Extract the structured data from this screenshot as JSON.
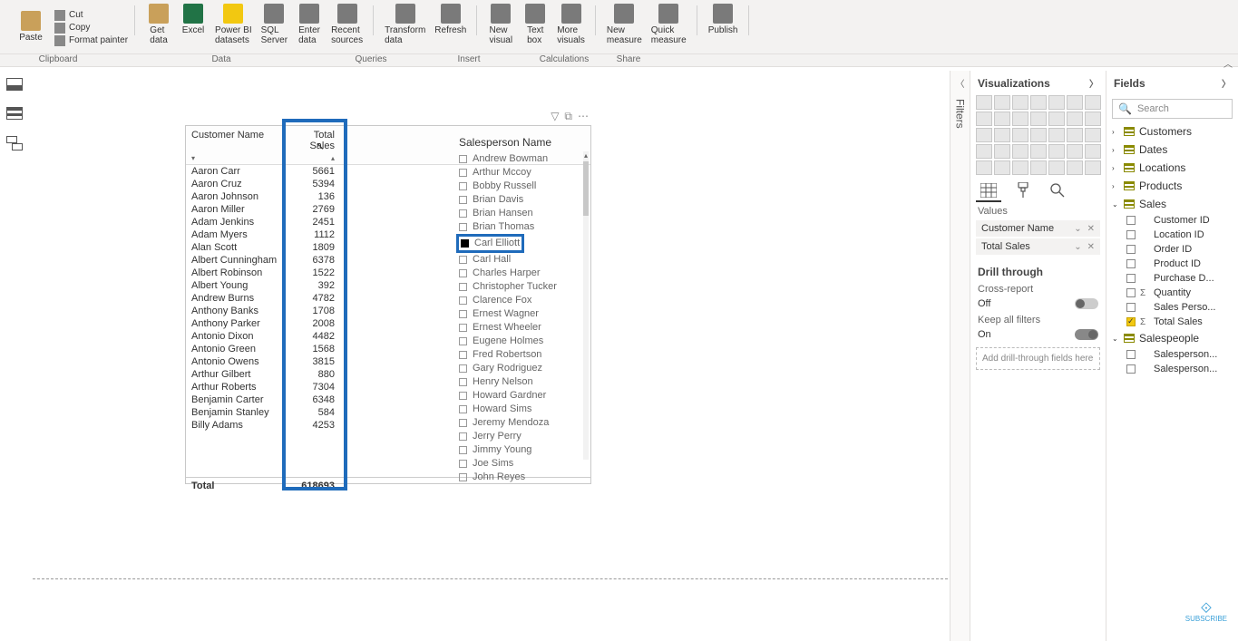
{
  "ribbon": {
    "clipboard": {
      "paste": "Paste",
      "cut": "Cut",
      "copy": "Copy",
      "format_painter": "Format painter",
      "group": "Clipboard"
    },
    "data": {
      "get_data": "Get\ndata",
      "excel": "Excel",
      "pbi_datasets": "Power BI\ndatasets",
      "sql": "SQL\nServer",
      "enter": "Enter\ndata",
      "recent": "Recent\nsources",
      "group": "Data"
    },
    "queries": {
      "transform": "Transform\ndata",
      "refresh": "Refresh",
      "group": "Queries"
    },
    "insert": {
      "new_visual": "New\nvisual",
      "text_box": "Text\nbox",
      "more_visuals": "More\nvisuals",
      "group": "Insert"
    },
    "calc": {
      "new_measure": "New\nmeasure",
      "quick_measure": "Quick\nmeasure",
      "group": "Calculations"
    },
    "share": {
      "publish": "Publish",
      "group": "Share"
    }
  },
  "filters_rail": "Filters",
  "table_visual": {
    "col1": "Customer Name",
    "col2": "Total Sales",
    "rows": [
      [
        "Aaron Carr",
        "5661"
      ],
      [
        "Aaron Cruz",
        "5394"
      ],
      [
        "Aaron Johnson",
        "136"
      ],
      [
        "Aaron Miller",
        "2769"
      ],
      [
        "Adam Jenkins",
        "2451"
      ],
      [
        "Adam Myers",
        "1112"
      ],
      [
        "Alan Scott",
        "1809"
      ],
      [
        "Albert Cunningham",
        "6378"
      ],
      [
        "Albert Robinson",
        "1522"
      ],
      [
        "Albert Young",
        "392"
      ],
      [
        "Andrew Burns",
        "4782"
      ],
      [
        "Anthony Banks",
        "1708"
      ],
      [
        "Anthony Parker",
        "2008"
      ],
      [
        "Antonio Dixon",
        "4482"
      ],
      [
        "Antonio Green",
        "1568"
      ],
      [
        "Antonio Owens",
        "3815"
      ],
      [
        "Arthur Gilbert",
        "880"
      ],
      [
        "Arthur Roberts",
        "7304"
      ],
      [
        "Benjamin Carter",
        "6348"
      ],
      [
        "Benjamin Stanley",
        "584"
      ],
      [
        "Billy Adams",
        "4253"
      ]
    ],
    "total_label": "Total",
    "total_value": "618693"
  },
  "slicer": {
    "title": "Salesperson Name",
    "items": [
      "Andrew Bowman",
      "Arthur Mccoy",
      "Bobby Russell",
      "Brian Davis",
      "Brian Hansen",
      "Brian Thomas",
      "Carl Elliott",
      "Carl Hall",
      "Charles Harper",
      "Christopher Tucker",
      "Clarence Fox",
      "Ernest Wagner",
      "Ernest Wheeler",
      "Eugene Holmes",
      "Fred Robertson",
      "Gary Rodriguez",
      "Henry Nelson",
      "Howard Gardner",
      "Howard Sims",
      "Jeremy Mendoza",
      "Jerry Perry",
      "Jimmy Young",
      "Joe Sims",
      "John Reyes"
    ],
    "highlighted_index": 6
  },
  "viz_panel": {
    "title": "Visualizations",
    "values_label": "Values",
    "wells": [
      "Customer Name",
      "Total Sales"
    ],
    "drill_title": "Drill through",
    "cross_report": "Cross-report",
    "cross_report_val": "Off",
    "keep_filters": "Keep all filters",
    "keep_filters_val": "On",
    "drop_hint": "Add drill-through fields here"
  },
  "fields_panel": {
    "title": "Fields",
    "search_placeholder": "Search",
    "tables": [
      {
        "name": "Customers",
        "expanded": false
      },
      {
        "name": "Dates",
        "expanded": false
      },
      {
        "name": "Locations",
        "expanded": false
      },
      {
        "name": "Products",
        "expanded": false
      },
      {
        "name": "Sales",
        "expanded": true,
        "fields": [
          {
            "label": "Customer ID",
            "checked": false,
            "sigma": false
          },
          {
            "label": "Location ID",
            "checked": false,
            "sigma": false
          },
          {
            "label": "Order ID",
            "checked": false,
            "sigma": false
          },
          {
            "label": "Product ID",
            "checked": false,
            "sigma": false
          },
          {
            "label": "Purchase D...",
            "checked": false,
            "sigma": false
          },
          {
            "label": "Quantity",
            "checked": false,
            "sigma": true
          },
          {
            "label": "Sales Perso...",
            "checked": false,
            "sigma": false
          },
          {
            "label": "Total Sales",
            "checked": true,
            "sigma": true
          }
        ]
      },
      {
        "name": "Salespeople",
        "expanded": true,
        "fields": [
          {
            "label": "Salesperson...",
            "checked": false,
            "sigma": false
          },
          {
            "label": "Salesperson...",
            "checked": false,
            "sigma": false
          }
        ]
      }
    ]
  },
  "subscribe": "SUBSCRIBE"
}
